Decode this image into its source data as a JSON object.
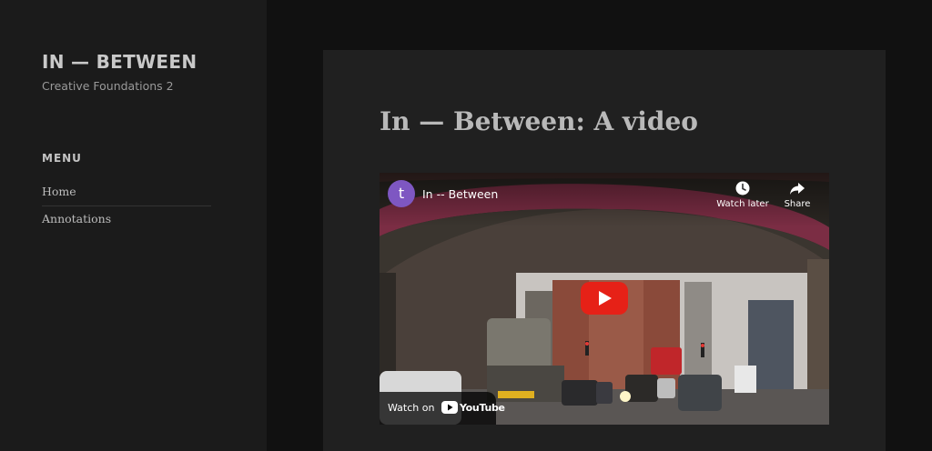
{
  "site": {
    "title": "IN — BETWEEN",
    "description": "Creative Foundations 2"
  },
  "menu": {
    "heading": "MENU",
    "items": [
      {
        "label": "Home"
      },
      {
        "label": "Annotations"
      }
    ]
  },
  "post": {
    "title": "In — Between: A video"
  },
  "video": {
    "channel_initial": "t",
    "title": "In -- Between",
    "watch_later_label": "Watch later",
    "share_label": "Share",
    "watch_on_label": "Watch on",
    "youtube_label": "YouTube"
  },
  "colors": {
    "sidebar_bg": "#1b1b1b",
    "page_bg": "#111111",
    "card_bg": "#202020",
    "avatar": "#7e57c2",
    "play_red": "#e62117"
  },
  "icons": [
    "clock-icon",
    "share-arrow-icon",
    "play-icon",
    "youtube-logo-icon"
  ]
}
